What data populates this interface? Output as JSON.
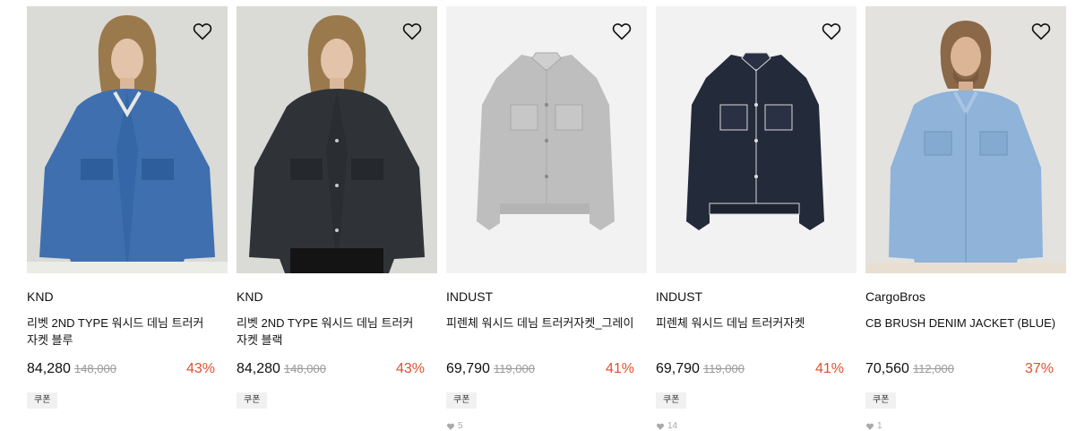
{
  "products": [
    {
      "brand": "KND",
      "title": "리벳 2ND TYPE 워시드 데님 트러커 자켓 블루",
      "price": "84,280",
      "original_price": "148,000",
      "discount": "43%",
      "coupon": "쿠폰",
      "likes": ""
    },
    {
      "brand": "KND",
      "title": "리벳 2ND TYPE 워시드 데님 트러커 자켓 블랙",
      "price": "84,280",
      "original_price": "148,000",
      "discount": "43%",
      "coupon": "쿠폰",
      "likes": ""
    },
    {
      "brand": "INDUST",
      "title": "피렌체 워시드 데님 트러커자켓_그레이",
      "price": "69,790",
      "original_price": "119,000",
      "discount": "41%",
      "coupon": "쿠폰",
      "likes": "5"
    },
    {
      "brand": "INDUST",
      "title": "피렌체 워시드 데님 트러커자켓",
      "price": "69,790",
      "original_price": "119,000",
      "discount": "41%",
      "coupon": "쿠폰",
      "likes": "14"
    },
    {
      "brand": "CargoBros",
      "title": "CB BRUSH DENIM JACKET (BLUE)",
      "price": "70,560",
      "original_price": "112,000",
      "discount": "37%",
      "coupon": "쿠폰",
      "likes": "1"
    }
  ],
  "colors": {
    "discount": "#e0502e",
    "coupon_bg": "#f1f1f1"
  },
  "icons": {
    "wishlist": "heart-outline-icon",
    "likes": "heart-filled-icon"
  }
}
